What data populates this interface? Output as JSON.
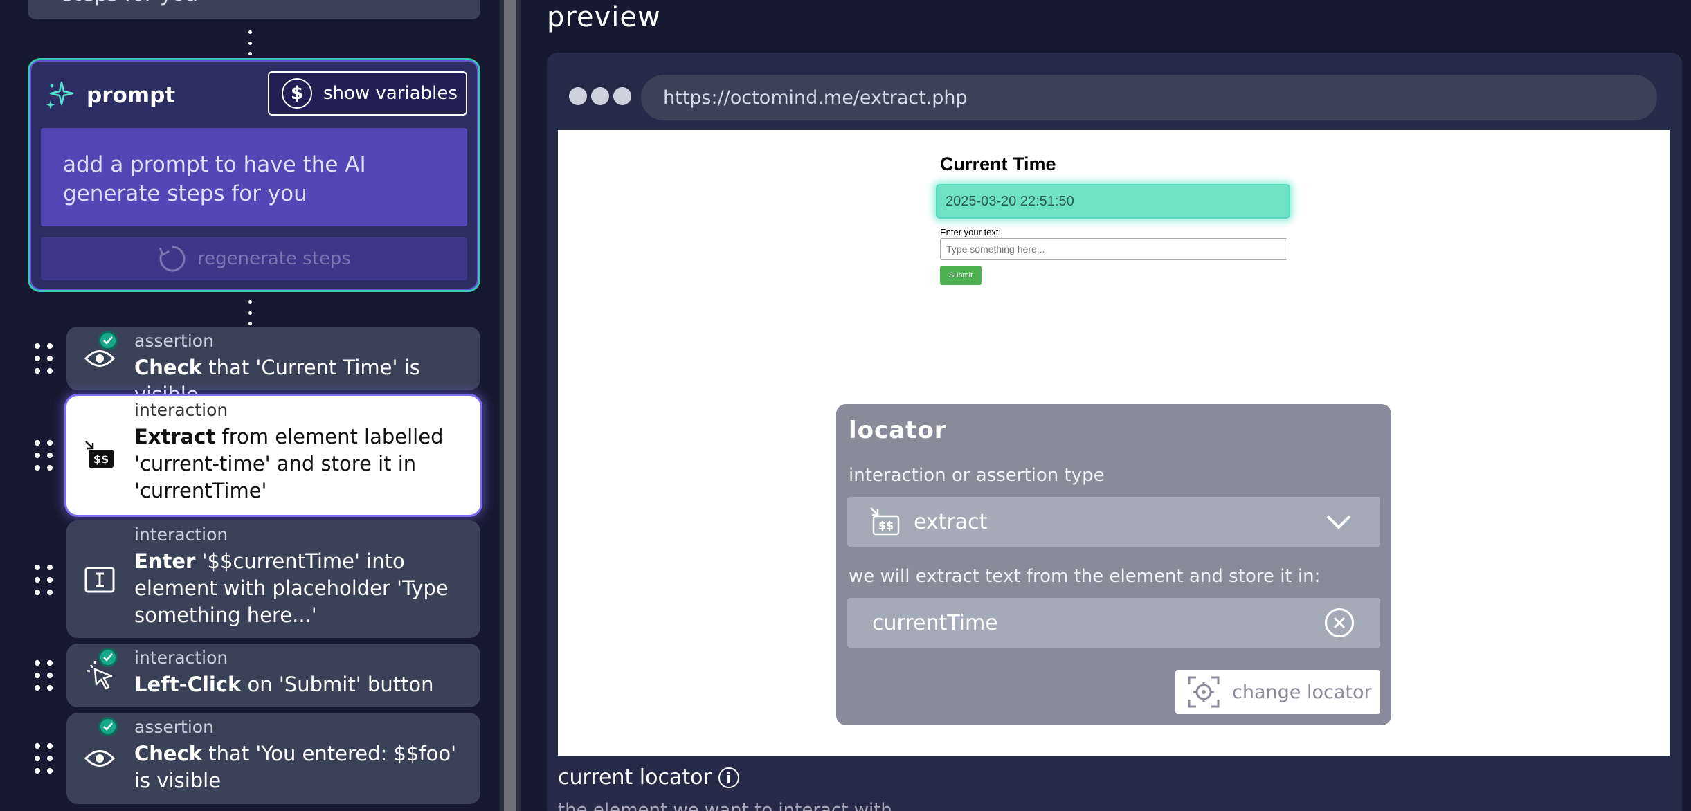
{
  "steps_panel": {
    "top_cut_text": "steps for you",
    "prompt": {
      "title": "prompt",
      "show_variables": "show variables",
      "placeholder": "add a prompt to have the AI generate steps for you",
      "regenerate": "regenerate steps"
    },
    "steps": [
      {
        "kind": "assertion",
        "verb": "Check",
        "rest": " that 'Current Time' is visible",
        "icon": "eye-icon",
        "checked": true
      },
      {
        "kind": "interaction",
        "verb": "Extract",
        "rest": " from element labelled 'current-time' and store it in 'currentTime'",
        "icon": "extract-icon",
        "checked": false,
        "selected": true
      },
      {
        "kind": "interaction",
        "verb": "Enter",
        "rest": " '$$currentTime' into element with placeholder 'Type something here...'",
        "icon": "text-cursor-icon",
        "checked": false
      },
      {
        "kind": "interaction",
        "verb": "Left-Click",
        "rest": " on 'Submit' button",
        "icon": "pointer-click-icon",
        "checked": true
      },
      {
        "kind": "assertion",
        "verb": "Check",
        "rest": " that 'You entered: $$foo' is visible",
        "icon": "eye-icon",
        "checked": true
      }
    ]
  },
  "preview": {
    "title": "preview",
    "url": "https://octomind.me/extract.php",
    "site": {
      "title": "Current Time",
      "time_value": "2025-03-20 22:51:50",
      "input_label": "Enter your text:",
      "input_placeholder": "Type something here...",
      "submit": "Submit"
    },
    "locator": {
      "heading": "locator",
      "type_label": "interaction or assertion type",
      "type_value": "extract",
      "store_label": "we will extract text from the element and store it in:",
      "store_value": "currentTime",
      "change_locator": "change locator"
    },
    "current_locator": "current locator",
    "cut_text": "the element we want to interact with"
  },
  "colors": {
    "background": "#161a30",
    "accent_teal": "#35c7b4",
    "accent_purple": "#5147b5",
    "step_bg": "#3a4258",
    "submit_green": "#4caf50"
  }
}
